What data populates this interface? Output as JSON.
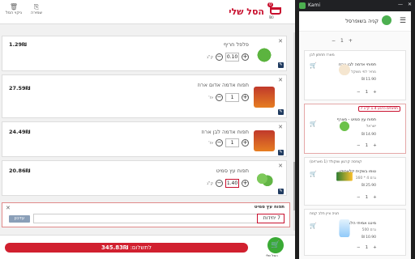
{
  "cart": {
    "title": "הסל שלי",
    "item_count": "0",
    "header_total": "₪0",
    "clear_label": "ניקוי הסל",
    "save_label": "שמירה",
    "items": [
      {
        "name": "פלפל חריף",
        "qty": "0.10",
        "unit": "ק\"ג",
        "price": "1.29₪"
      },
      {
        "name": "תפוח אדמה אדום ארוז",
        "qty": "1",
        "unit": "יח'",
        "price": "27.59₪"
      },
      {
        "name": "תפוח אדמה לבן ארוז",
        "qty": "1",
        "unit": "יח'",
        "price": "24.49₪"
      },
      {
        "name": "תפוח עץ סמיט",
        "qty": "1.40",
        "unit": "ק\"ג",
        "price": "20.86₪"
      }
    ],
    "note": {
      "title": "תפוח עץ סמיט",
      "value": "7 יחידות",
      "update_label": "עדכון"
    },
    "pay_label": "לתשלום:",
    "pay_amount": "345.83₪",
    "footer_cart_label": "הסל שלי"
  },
  "kami": {
    "app_name": "Kami",
    "page_title": "קניה בשופרסל",
    "top_qty": "1",
    "cards": [
      {
        "cat": "משק ושפון ברכה",
        "title": "ביצים אורגניות",
        "sub": "",
        "price": "",
        "qty": "1"
      },
      {
        "cat": "מארז תחתון לבן",
        "title": "תפוחי אדמה לבן ארוז",
        "sub": "מחיר לפי משקל",
        "price": "₪ 11.90",
        "qty": "1"
      },
      {
        "badge": "7 תפוחים כרגע 1.4 ק\"ג",
        "cat": "",
        "title": "תפוח עץ סמיט - מצרף",
        "sub": "ישראל",
        "price": "₪ 14.90",
        "qty": "1"
      },
      {
        "cat": "קופסה קרטון שוקולד (1 מארזים)",
        "title": "טופו בשקית קלאסיקו",
        "sub": "160 * 4 גרם",
        "price": "₪ 25.90",
        "qty": "1"
      },
      {
        "cat": "חגיה ציין חלב קמח",
        "title": "מינגו אמיתי הלבאה",
        "sub": "500 גרם",
        "price": "₪ 10.90",
        "qty": "1"
      }
    ]
  },
  "colors": {
    "brand_red": "#c8102e",
    "brand_green": "#3aaa35",
    "accent_navy": "#1f3a5f"
  }
}
